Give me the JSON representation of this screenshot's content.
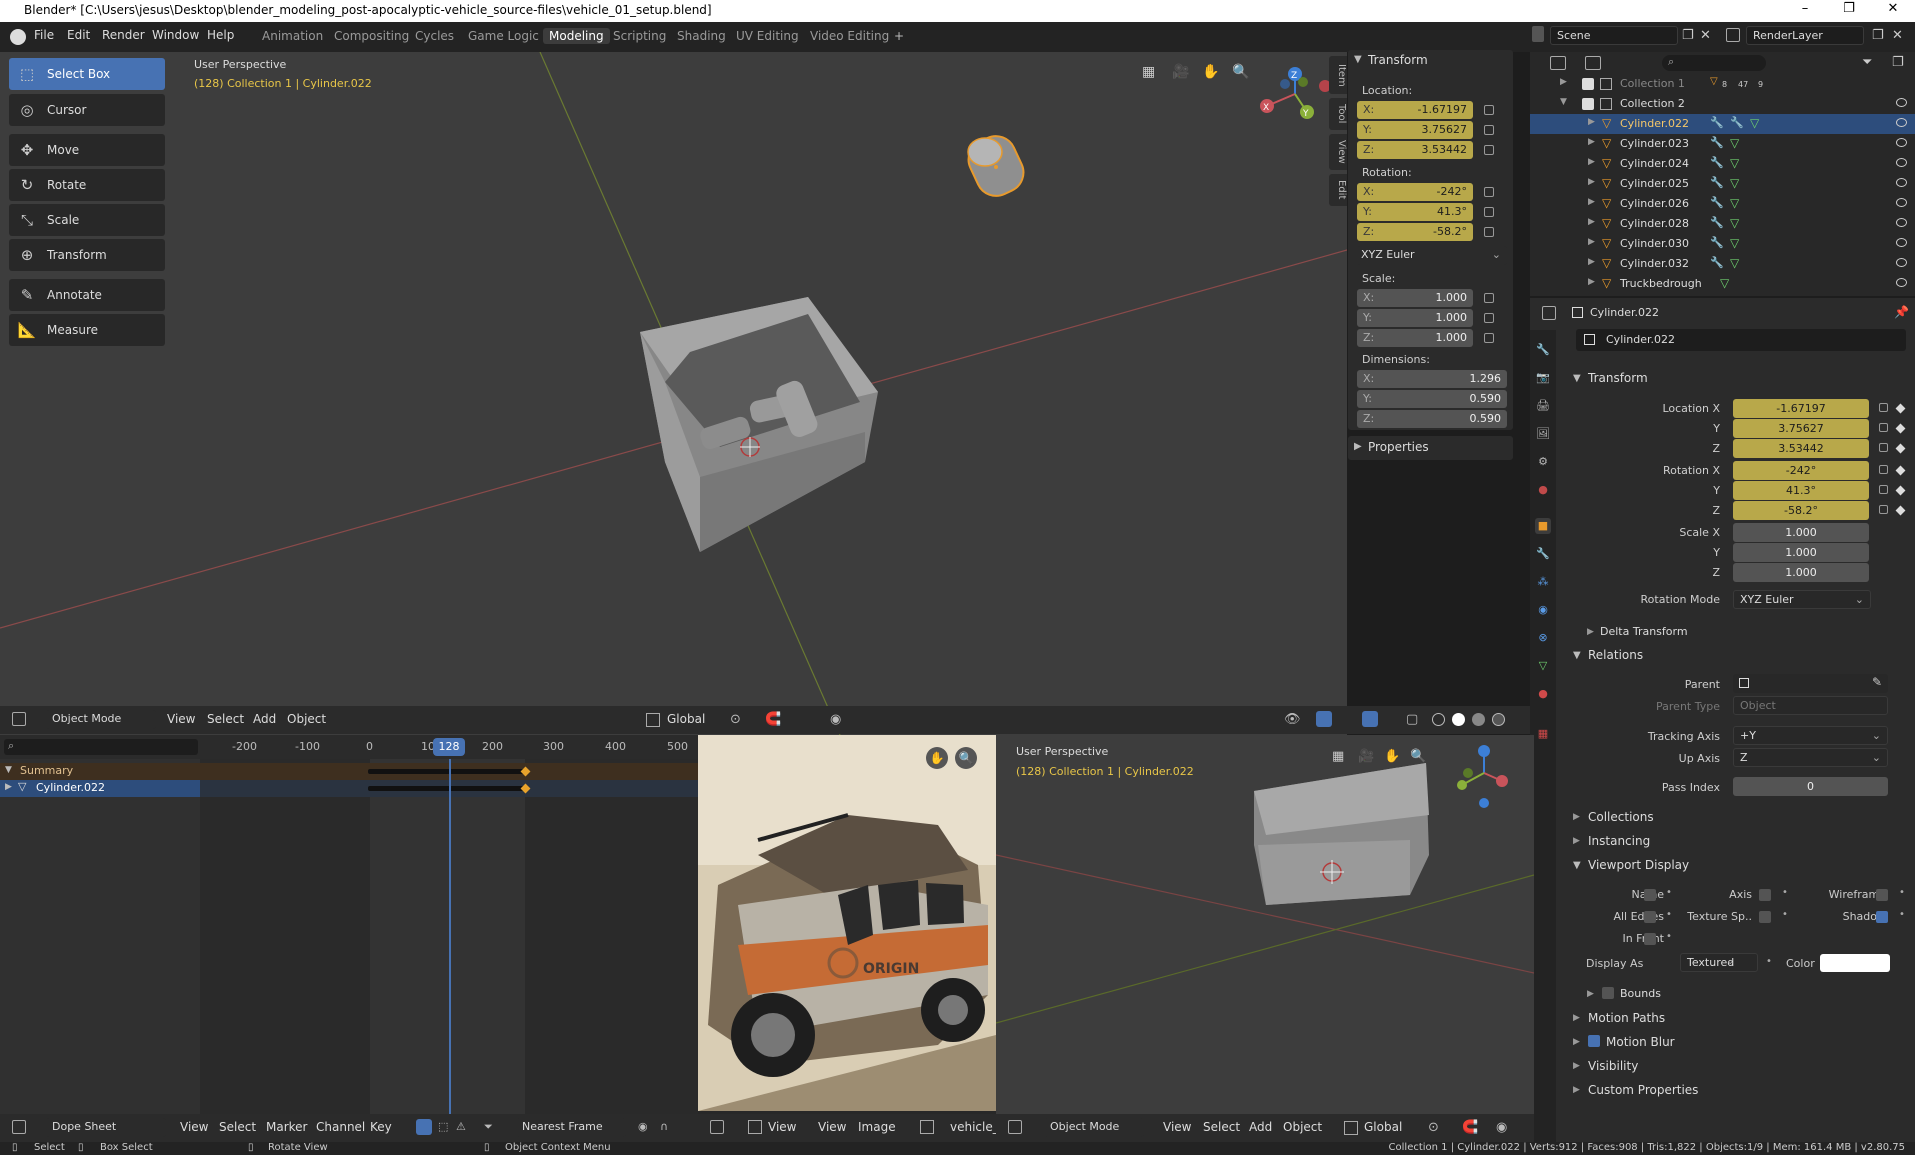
{
  "titlebar": {
    "title": "Blender* [C:\\Users\\jesus\\Desktop\\blender_modeling_post-apocalyptic-vehicle_source-files\\vehicle_01_setup.blend]",
    "minimize": "–",
    "restore": "❐",
    "close": "✕"
  },
  "menu": {
    "items": [
      "File",
      "Edit",
      "Render",
      "Window",
      "Help"
    ],
    "workspaces": [
      "Animation",
      "Compositing",
      "Cycles",
      "Game Logic",
      "Modeling",
      "Scripting",
      "Shading",
      "UV Editing",
      "Video Editing"
    ],
    "active_workspace": "Modeling",
    "add_workspace": "+",
    "scene": "Scene",
    "renderlayer": "RenderLayer"
  },
  "viewport": {
    "view_name": "User Perspective",
    "collection_info": "(128) Collection 1 | Cylinder.022",
    "tools": [
      "Select Box",
      "Cursor",
      "Move",
      "Rotate",
      "Scale",
      "Transform",
      "Annotate",
      "Measure"
    ],
    "header": {
      "mode": "Object Mode",
      "view": "View",
      "select": "Select",
      "add": "Add",
      "object": "Object",
      "orientation": "Global"
    },
    "gizmo": {
      "x": "X",
      "y": "Y",
      "z": "Z"
    }
  },
  "npanel": {
    "tabs": [
      "Item",
      "Tool",
      "View",
      "Edit"
    ],
    "transform_title": "Transform",
    "location_label": "Location:",
    "location": [
      {
        "axis": "X:",
        "value": "-1.67197"
      },
      {
        "axis": "Y:",
        "value": "3.75627"
      },
      {
        "axis": "Z:",
        "value": "3.53442"
      }
    ],
    "rotation_label": "Rotation:",
    "rotation": [
      {
        "axis": "X:",
        "value": "-242°"
      },
      {
        "axis": "Y:",
        "value": "41.3°"
      },
      {
        "axis": "Z:",
        "value": "-58.2°"
      }
    ],
    "rotation_mode": "XYZ Euler",
    "scale_label": "Scale:",
    "scale": [
      {
        "axis": "X:",
        "value": "1.000"
      },
      {
        "axis": "Y:",
        "value": "1.000"
      },
      {
        "axis": "Z:",
        "value": "1.000"
      }
    ],
    "dimensions_label": "Dimensions:",
    "dimensions": [
      {
        "axis": "X:",
        "value": "1.296"
      },
      {
        "axis": "Y:",
        "value": "0.590"
      },
      {
        "axis": "Z:",
        "value": "0.590"
      }
    ],
    "properties_title": "Properties"
  },
  "outliner": {
    "rows": [
      {
        "name": "Collection 1",
        "dim": true
      },
      {
        "name": "Collection 2",
        "dim": false
      },
      {
        "name": "Cylinder.022",
        "dim": false
      },
      {
        "name": "Cylinder.023",
        "dim": false
      },
      {
        "name": "Cylinder.024",
        "dim": false
      },
      {
        "name": "Cylinder.025",
        "dim": false
      },
      {
        "name": "Cylinder.026",
        "dim": false
      },
      {
        "name": "Cylinder.028",
        "dim": false
      },
      {
        "name": "Cylinder.030",
        "dim": false
      },
      {
        "name": "Cylinder.032",
        "dim": false
      },
      {
        "name": "Truckbedrough",
        "dim": false
      }
    ],
    "selected": "Cylinder.022",
    "collection1_counts": [
      "8",
      "47",
      "9"
    ]
  },
  "properties": {
    "object_name": "Cylinder.022",
    "object_field": "Cylinder.022",
    "transform_title": "Transform",
    "location_x_label": "Location X",
    "y_label": "Y",
    "z_label": "Z",
    "location": [
      "-1.67197",
      "3.75627",
      "3.53442"
    ],
    "rotation_x_label": "Rotation X",
    "rotation": [
      "-242°",
      "41.3°",
      "-58.2°"
    ],
    "scale_x_label": "Scale X",
    "scale": [
      "1.000",
      "1.000",
      "1.000"
    ],
    "rotation_mode_label": "Rotation Mode",
    "rotation_mode": "XYZ Euler",
    "delta_transform": "Delta Transform",
    "relations_title": "Relations",
    "parent_label": "Parent",
    "parent_type_label": "Parent Type",
    "parent_type": "Object",
    "tracking_axis_label": "Tracking Axis",
    "tracking_axis": "+Y",
    "up_axis_label": "Up Axis",
    "up_axis": "Z",
    "pass_index_label": "Pass Index",
    "pass_index": "0",
    "collections": "Collections",
    "instancing": "Instancing",
    "viewport_display": "Viewport Display",
    "vd_name": "Name",
    "vd_axis": "Axis",
    "vd_wireframe": "Wireframe",
    "vd_all_edges": "All Edges",
    "vd_texture": "Texture Sp..",
    "vd_shadow": "Shadow",
    "vd_in_front": "In Front",
    "display_as_label": "Display As",
    "display_as": "Textured",
    "color_label": "Color",
    "bounds": "Bounds",
    "motion_paths": "Motion Paths",
    "motion_blur": "Motion Blur",
    "visibility": "Visibility",
    "custom_properties": "Custom Properties"
  },
  "dopesheet": {
    "ticks": [
      "-200",
      "-100",
      "0",
      "10",
      "128",
      "200",
      "300",
      "400",
      "500"
    ],
    "current_frame": "128",
    "summary": "Summary",
    "channel": "Cylinder.022",
    "header": {
      "mode": "Dope Sheet",
      "view": "View",
      "select": "Select",
      "marker": "Marker",
      "channel": "Channel",
      "key": "Key",
      "snap": "Nearest Frame"
    }
  },
  "image_editor": {
    "view": "View",
    "view2": "View",
    "image": "Image",
    "image_name": "vehicle_",
    "decal_text": "ORIGIN"
  },
  "viewport2": {
    "view_name": "User Perspective",
    "collection_info": "(128) Collection 1 | Cylinder.022",
    "mode": "Object Mode",
    "view": "View",
    "select": "Select",
    "add": "Add",
    "object": "Object",
    "orientation": "Global"
  },
  "statusbar": {
    "select": "Select",
    "box_select": "Box Select",
    "rotate_view": "Rotate View",
    "context_menu": "Object Context Menu",
    "stats": "Collection 1 | Cylinder.022 | Verts:912 | Faces:908 | Tris:1,822 | Objects:1/9 | Mem: 161.4 MB | v2.80.75"
  },
  "colors": {
    "select_blue": "#4772b3",
    "anim_yellow": "#b8a84a",
    "x_axis": "#c9545b",
    "y_axis": "#8bb03a",
    "z_axis": "#3c7fd6",
    "selection_orange": "#e89a2c"
  }
}
